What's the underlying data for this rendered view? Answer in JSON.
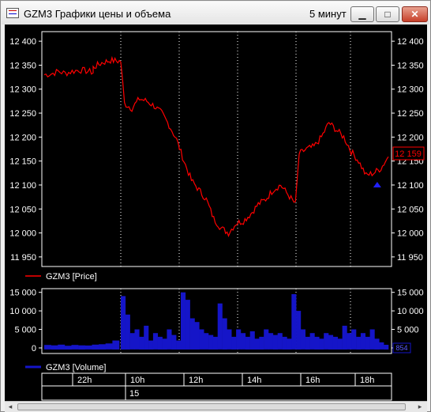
{
  "window": {
    "title": "GZM3 Графики цены и объема",
    "interval": "5 минут",
    "buttons": {
      "minimize": "▁",
      "maximize": "□",
      "close": "✕"
    }
  },
  "colors": {
    "background": "#000000",
    "frame": "#ffffff",
    "price_line": "#ff0000",
    "volume_fill": "#1515c8",
    "marker": "#2020ff",
    "text": "#ffffff"
  },
  "price_panel": {
    "legend": "GZM3 [Price]",
    "last_value_label": "12 159",
    "y_ticks": [
      "12 400",
      "12 350",
      "12 300",
      "12 250",
      "12 200",
      "12 150",
      "12 100",
      "12 050",
      "12 000",
      "11 950"
    ]
  },
  "volume_panel": {
    "legend": "GZM3 [Volume]",
    "last_value_label": "854",
    "y_ticks": [
      "15 000",
      "10 000",
      "5 000",
      "0"
    ]
  },
  "time_axis": {
    "hour_labels": [
      "22h",
      "10h",
      "12h",
      "14h",
      "16h",
      "18h"
    ],
    "day_labels": [
      "15"
    ]
  },
  "chart_data": [
    {
      "type": "line",
      "title": "",
      "series": [
        {
          "name": "GZM3 [Price]"
        }
      ],
      "ylim": [
        11930,
        12420
      ],
      "y_ticks": [
        12400,
        12350,
        12300,
        12250,
        12200,
        12150,
        12100,
        12050,
        12000,
        11950
      ],
      "x_ticks": [
        "22h",
        "10h",
        "12h",
        "14h",
        "16h",
        "18h"
      ],
      "points": [
        [
          "21:20",
          12330
        ],
        [
          "21:40",
          12332
        ],
        [
          "22:00",
          12337
        ],
        [
          "22:20",
          12333
        ],
        [
          "22:40",
          12337
        ],
        [
          "23:00",
          12340
        ],
        [
          "23:20",
          12338
        ],
        [
          "23:40",
          12335
        ],
        [
          "09:00",
          12345
        ],
        [
          "09:20",
          12355
        ],
        [
          "09:40",
          12360
        ],
        [
          "10:00",
          12358
        ],
        [
          "10:10",
          12270
        ],
        [
          "10:30",
          12260
        ],
        [
          "10:50",
          12280
        ],
        [
          "11:10",
          12275
        ],
        [
          "11:30",
          12265
        ],
        [
          "11:50",
          12250
        ],
        [
          "12:10",
          12225
        ],
        [
          "12:30",
          12195
        ],
        [
          "12:50",
          12150
        ],
        [
          "13:10",
          12110
        ],
        [
          "13:30",
          12090
        ],
        [
          "13:50",
          12070
        ],
        [
          "14:10",
          12030
        ],
        [
          "14:30",
          12010
        ],
        [
          "14:50",
          12000
        ],
        [
          "15:10",
          12020
        ],
        [
          "15:30",
          12025
        ],
        [
          "15:50",
          12040
        ],
        [
          "16:10",
          12060
        ],
        [
          "16:30",
          12070
        ],
        [
          "16:50",
          12090
        ],
        [
          "17:10",
          12100
        ],
        [
          "17:30",
          12080
        ],
        [
          "17:50",
          12060
        ],
        [
          "18:00",
          12165
        ],
        [
          "18:20",
          12175
        ],
        [
          "18:40",
          12180
        ],
        [
          "19:00",
          12200
        ],
        [
          "19:20",
          12230
        ],
        [
          "19:40",
          12215
        ],
        [
          "20:00",
          12200
        ],
        [
          "20:20",
          12170
        ],
        [
          "20:40",
          12150
        ],
        [
          "21:00",
          12120
        ],
        [
          "21:20",
          12125
        ],
        [
          "21:40",
          12135
        ],
        [
          "22:00",
          12159
        ]
      ],
      "marker": {
        "x": "21:30",
        "y": 12100
      }
    },
    {
      "type": "bar",
      "title": "",
      "series": [
        {
          "name": "GZM3 [Volume]"
        }
      ],
      "ylim": [
        -1500,
        16000
      ],
      "y_ticks": [
        15000,
        10000,
        5000,
        0
      ],
      "values": [
        800,
        700,
        900,
        600,
        800,
        700,
        650,
        900,
        1000,
        1200,
        2000,
        14000,
        9000,
        4000,
        5000,
        3000,
        6000,
        2000,
        4000,
        3000,
        2500,
        5000,
        3500,
        2000,
        15000,
        13000,
        8000,
        7000,
        5000,
        4000,
        3500,
        3000,
        12000,
        8000,
        5000,
        3000,
        5000,
        4000,
        3000,
        4500,
        2500,
        3000,
        5000,
        4000,
        3500,
        4000,
        3000,
        2500,
        14500,
        10000,
        5000,
        3000,
        4000,
        3000,
        2500,
        4000,
        3500,
        3000,
        2500,
        6000,
        4000,
        5000,
        3000,
        4000,
        3000,
        5000,
        2500,
        1500,
        854
      ]
    }
  ]
}
